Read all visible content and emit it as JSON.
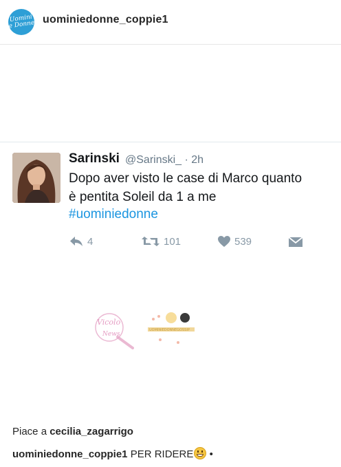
{
  "header": {
    "avatar_text": "Uomini e Donne",
    "username": "uominiedonne_coppie1"
  },
  "tweet": {
    "name": "Sarinski",
    "handle": "@Sarinski_ · 2h",
    "text_line1": "Dopo aver visto le case di Marco quanto",
    "text_line2": "è pentita Soleil da 1 a me",
    "hashtag": "#uominiedonne",
    "reply_count": "4",
    "retweet_count": "101",
    "like_count": "539"
  },
  "watermark": {
    "script_text": "Vicolo delle News",
    "small_text": "UOMINIEDONNEGOSSIP"
  },
  "likes": {
    "prefix": "Piace a",
    "user": "cecilia_zagarrigo"
  },
  "caption": {
    "user": "uominiedonne_coppie1",
    "text": "PER RIDERE",
    "trailing": "•"
  },
  "colors": {
    "accent_blue": "#1b95e0",
    "icon_gray": "#8899a6",
    "brand_blue": "#2e9fd6"
  }
}
